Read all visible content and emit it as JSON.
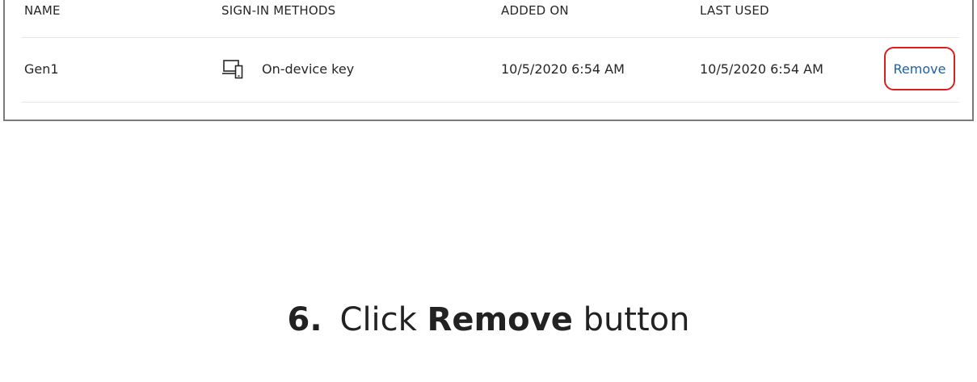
{
  "table": {
    "columns": {
      "name": "NAME",
      "sign_in_methods": "SIGN-IN METHODS",
      "added_on": "ADDED ON",
      "last_used": "LAST USED"
    },
    "rows": [
      {
        "name": "Gen1",
        "method_icon": "device-key-icon",
        "method": "On-device key",
        "added_on": "10/5/2020 6:54 AM",
        "last_used": "10/5/2020 6:54 AM",
        "action_label": "Remove"
      }
    ]
  },
  "instruction": {
    "step_number": "6.",
    "prefix": "Click",
    "emphasis": "Remove",
    "suffix": "button"
  },
  "colors": {
    "link_blue": "#1f5f9e",
    "highlight_red": "#d81e1e",
    "frame_gray": "#7a7a7a",
    "divider_gray": "#e6e6e6"
  }
}
